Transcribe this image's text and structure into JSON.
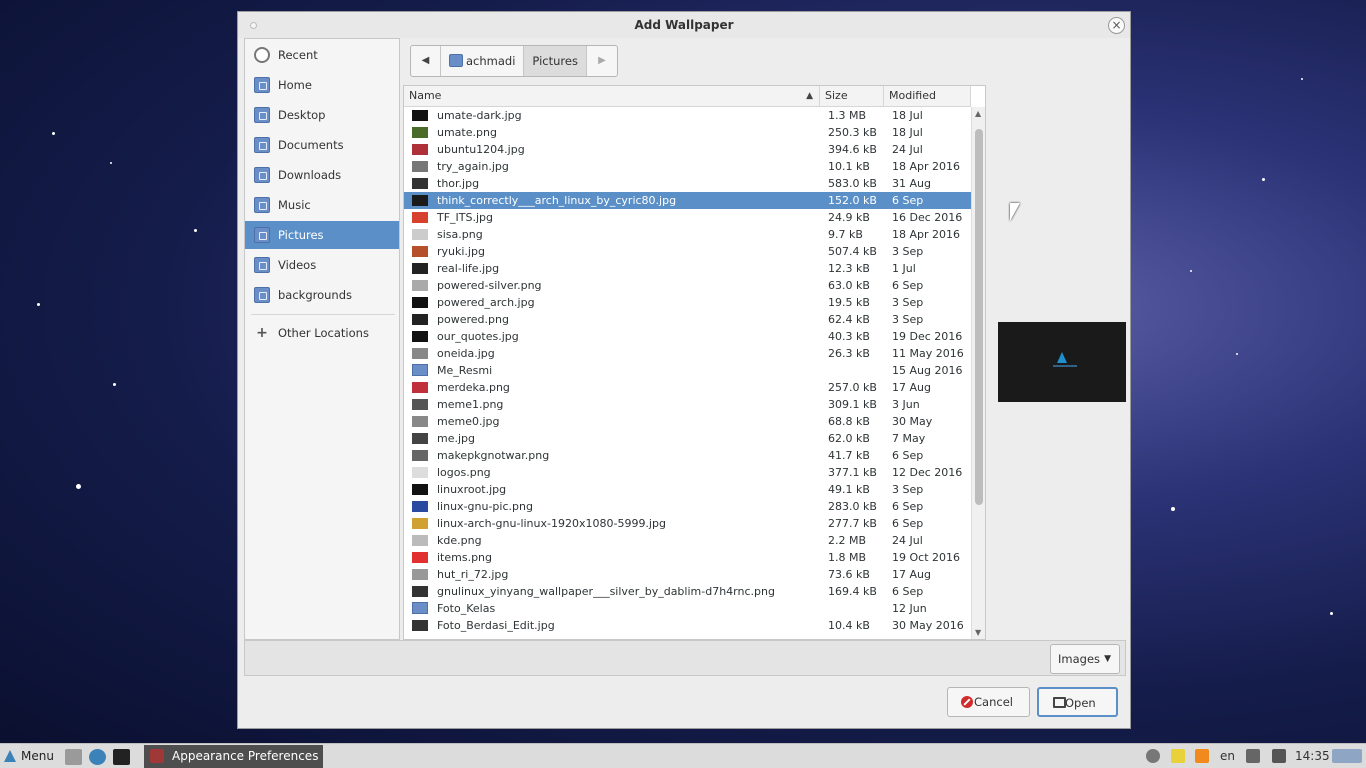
{
  "dialog": {
    "title": "Add Wallpaper"
  },
  "sidebar": {
    "items": [
      {
        "label": "Recent",
        "icon": "clock-icon"
      },
      {
        "label": "Home",
        "icon": "home-folder-icon"
      },
      {
        "label": "Desktop",
        "icon": "desktop-folder-icon"
      },
      {
        "label": "Documents",
        "icon": "documents-folder-icon"
      },
      {
        "label": "Downloads",
        "icon": "downloads-folder-icon"
      },
      {
        "label": "Music",
        "icon": "music-folder-icon"
      },
      {
        "label": "Pictures",
        "icon": "pictures-folder-icon",
        "selected": true
      },
      {
        "label": "Videos",
        "icon": "videos-folder-icon"
      },
      {
        "label": "backgrounds",
        "icon": "folder-icon"
      },
      {
        "label": "Other Locations",
        "icon": "plus-icon"
      }
    ]
  },
  "pathbar": {
    "crumbs": [
      "achmadi",
      "Pictures"
    ]
  },
  "columns": {
    "name": "Name",
    "size": "Size",
    "modified": "Modified"
  },
  "files": [
    {
      "name": "umate-dark.jpg",
      "size": "1.3 MB",
      "modified": "18 Jul"
    },
    {
      "name": "umate.png",
      "size": "250.3 kB",
      "modified": "18 Jul"
    },
    {
      "name": "ubuntu1204.jpg",
      "size": "394.6 kB",
      "modified": "24 Jul"
    },
    {
      "name": "try_again.jpg",
      "size": "10.1 kB",
      "modified": "18 Apr 2016"
    },
    {
      "name": "thor.jpg",
      "size": "583.0 kB",
      "modified": "31 Aug"
    },
    {
      "name": "think_correctly___arch_linux_by_cyric80.jpg",
      "size": "152.0 kB",
      "modified": "6 Sep",
      "selected": true
    },
    {
      "name": "TF_ITS.jpg",
      "size": "24.9 kB",
      "modified": "16 Dec 2016"
    },
    {
      "name": "sisa.png",
      "size": "9.7 kB",
      "modified": "18 Apr 2016"
    },
    {
      "name": "ryuki.jpg",
      "size": "507.4 kB",
      "modified": "3 Sep"
    },
    {
      "name": "real-life.jpg",
      "size": "12.3 kB",
      "modified": "1 Jul"
    },
    {
      "name": "powered-silver.png",
      "size": "63.0 kB",
      "modified": "6 Sep"
    },
    {
      "name": "powered_arch.jpg",
      "size": "19.5 kB",
      "modified": "3 Sep"
    },
    {
      "name": "powered.png",
      "size": "62.4 kB",
      "modified": "3 Sep"
    },
    {
      "name": "our_quotes.jpg",
      "size": "40.3 kB",
      "modified": "19 Dec 2016"
    },
    {
      "name": "oneida.jpg",
      "size": "26.3 kB",
      "modified": "11 May 2016"
    },
    {
      "name": "Me_Resmi",
      "size": "",
      "modified": "15 Aug 2016",
      "folder": true
    },
    {
      "name": "merdeka.png",
      "size": "257.0 kB",
      "modified": "17 Aug"
    },
    {
      "name": "meme1.png",
      "size": "309.1 kB",
      "modified": "3 Jun"
    },
    {
      "name": "meme0.jpg",
      "size": "68.8 kB",
      "modified": "30 May"
    },
    {
      "name": "me.jpg",
      "size": "62.0 kB",
      "modified": "7 May"
    },
    {
      "name": "makepkgnotwar.png",
      "size": "41.7 kB",
      "modified": "6 Sep"
    },
    {
      "name": "logos.png",
      "size": "377.1 kB",
      "modified": "12 Dec 2016"
    },
    {
      "name": "linuxroot.jpg",
      "size": "49.1 kB",
      "modified": "3 Sep"
    },
    {
      "name": "linux-gnu-pic.png",
      "size": "283.0 kB",
      "modified": "6 Sep"
    },
    {
      "name": "linux-arch-gnu-linux-1920x1080-5999.jpg",
      "size": "277.7 kB",
      "modified": "6 Sep"
    },
    {
      "name": "kde.png",
      "size": "2.2 MB",
      "modified": "24 Jul"
    },
    {
      "name": "items.png",
      "size": "1.8 MB",
      "modified": "19 Oct 2016"
    },
    {
      "name": "hut_ri_72.jpg",
      "size": "73.6 kB",
      "modified": "17 Aug"
    },
    {
      "name": "gnulinux_yinyang_wallpaper___silver_by_dablim-d7h4rnc.png",
      "size": "169.4 kB",
      "modified": "6 Sep"
    },
    {
      "name": "Foto_Kelas",
      "size": "",
      "modified": "12 Jun",
      "folder": true
    },
    {
      "name": "Foto_Berdasi_Edit.jpg",
      "size": "10.4 kB",
      "modified": "30 May 2016"
    }
  ],
  "filter": {
    "label": "Images"
  },
  "buttons": {
    "cancel": "Cancel",
    "open": "Open"
  },
  "taskbar": {
    "menu_label": "Menu",
    "app_label": "Appearance Preferences",
    "lang": "en",
    "clock": "14:35"
  },
  "colors": {
    "selection": "#5b8fc7",
    "folder": "#6a8fc8",
    "cancel_icon": "#d12c2c"
  }
}
